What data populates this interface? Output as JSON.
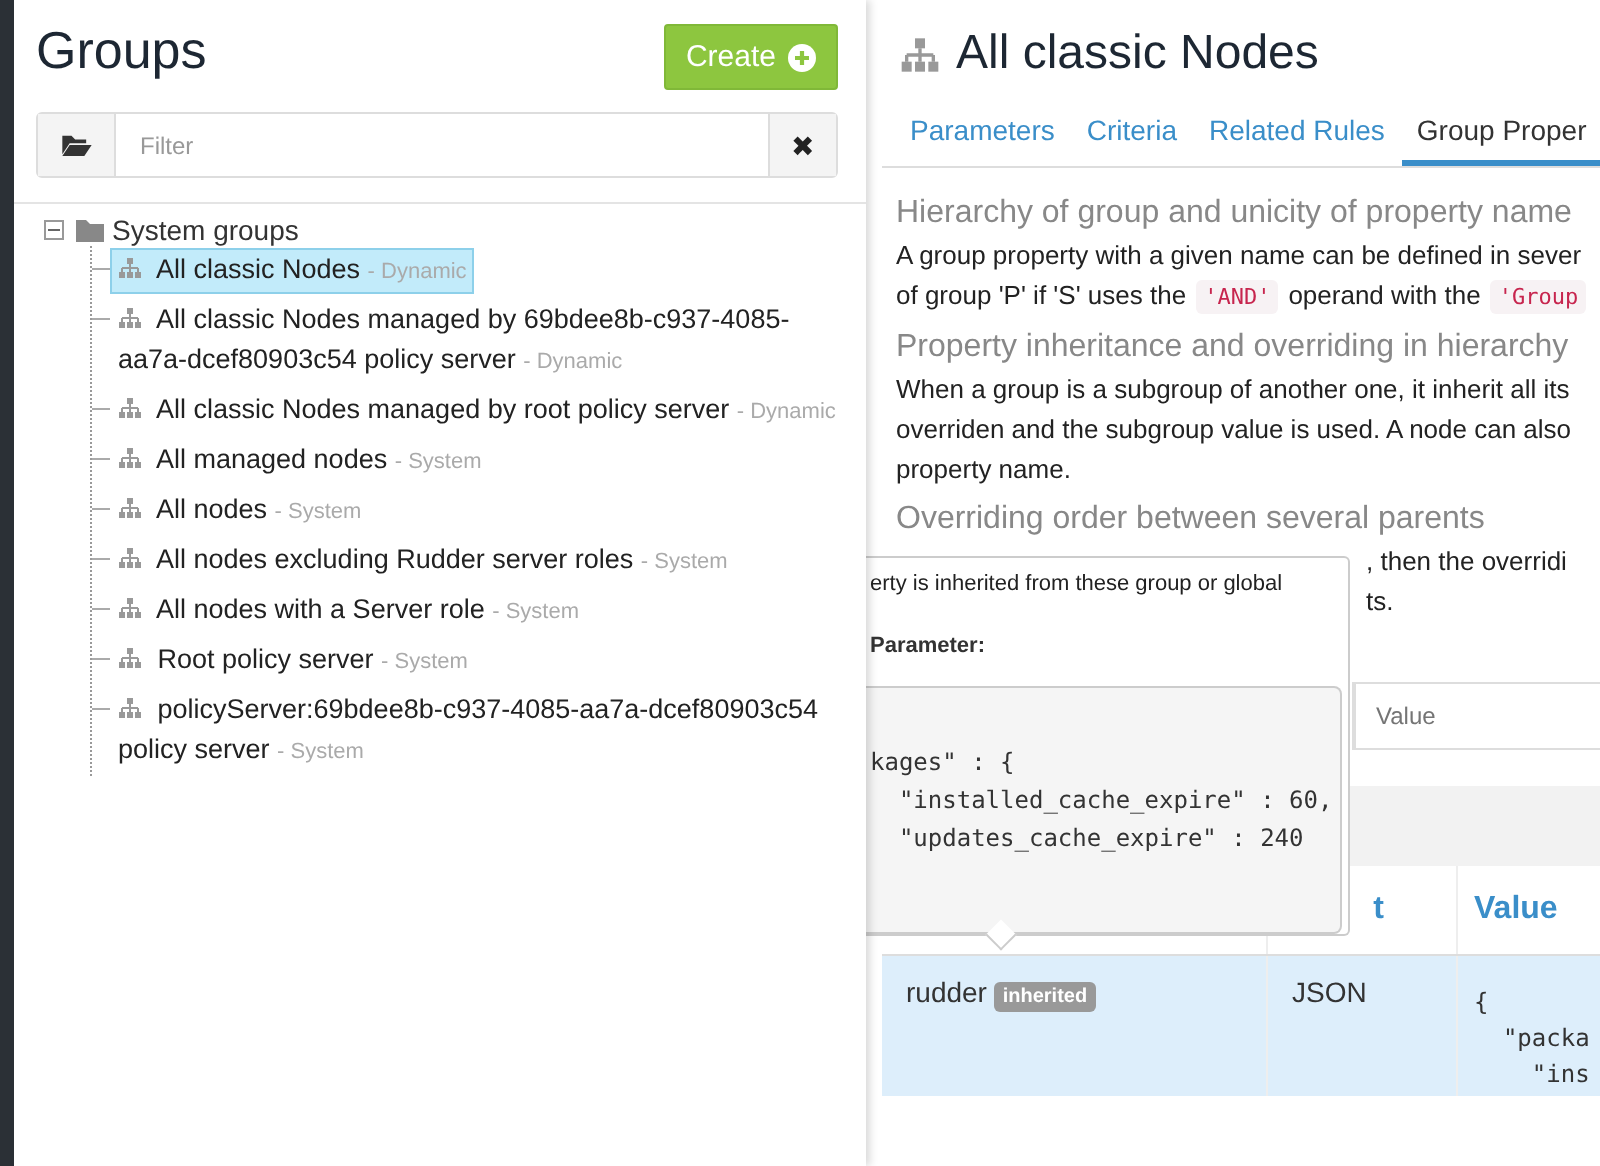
{
  "left_panel": {
    "title": "Groups",
    "create_button": "Create",
    "filter": {
      "placeholder": "Filter"
    },
    "clear_button": "✖",
    "tree": {
      "label": "System groups",
      "expanded": true,
      "children": [
        {
          "name": "All classic Nodes",
          "note": "- Dynamic",
          "selected": true
        },
        {
          "name": "All classic Nodes managed by 69bdee8b-c937-4085-aa7a-dcef80903c54 policy server",
          "note": "- Dynamic",
          "selected": false
        },
        {
          "name": "All classic Nodes managed by root policy server",
          "note": "- Dynamic",
          "selected": false
        },
        {
          "name": "All managed nodes",
          "note": "- System",
          "selected": false
        },
        {
          "name": "All nodes",
          "note": "- System",
          "selected": false
        },
        {
          "name": "All nodes excluding Rudder server roles",
          "note": "- System",
          "selected": false
        },
        {
          "name": "All nodes with a Server role",
          "note": "- System",
          "selected": false
        },
        {
          "name": "Root policy server",
          "note": "- System",
          "selected": false
        },
        {
          "name": "policyServer:69bdee8b-c937-4085-aa7a-dcef80903c54 policy server",
          "note": "- System",
          "selected": false
        }
      ]
    }
  },
  "right_panel": {
    "title": "All classic Nodes",
    "tabs": [
      {
        "label": "Parameters",
        "selected": false
      },
      {
        "label": "Criteria",
        "selected": false
      },
      {
        "label": "Related Rules",
        "selected": false
      },
      {
        "label": "Group Proper",
        "selected": true
      }
    ],
    "sections": [
      {
        "heading": "Hierarchy of group and unicity of property name",
        "lines": [
          [
            {
              "text": "A group property with a given name can be defined in sever"
            }
          ],
          [
            {
              "text": "of group 'P' if 'S' uses the"
            },
            {
              "text": "'AND'",
              "code": true
            },
            {
              "text": "operand with the"
            },
            {
              "text": "'Group",
              "code": true
            }
          ]
        ]
      },
      {
        "heading": "Property inheritance and overriding in hierarchy",
        "lines": [
          [
            {
              "text": "When a group is a subgroup of another one, it inherit all its"
            }
          ],
          [
            {
              "text": "overriden and the subgroup value is used. A node can also"
            }
          ],
          [
            {
              "text": "property name."
            }
          ]
        ]
      },
      {
        "heading": "Overriding order between several parents"
      }
    ],
    "behind_popover_lines": [
      ", then the overridi",
      "ts."
    ],
    "value_filter": {
      "placeholder": "Value"
    },
    "table": {
      "columns": [
        "t",
        "Value"
      ],
      "rows": [
        {
          "name": "rudder",
          "badge": "inherited",
          "format": "JSON",
          "value_lines": [
            "{",
            "  \"packa",
            "    \"ins"
          ],
          "selected": true
        }
      ]
    },
    "popover": {
      "text": "erty is inherited from these group or global",
      "label": "Parameter:",
      "code_lines": [
        "kages\" : {",
        "  \"installed_cache_expire\" : 60,",
        "  \"updates_cache_expire\" : 240"
      ]
    }
  }
}
